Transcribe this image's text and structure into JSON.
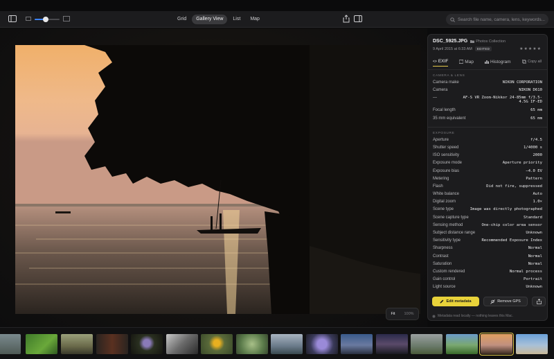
{
  "toolbar": {
    "views": [
      {
        "label": "Grid",
        "active": false
      },
      {
        "label": "Gallery View",
        "active": true
      },
      {
        "label": "List",
        "active": false
      },
      {
        "label": "Map",
        "active": false
      }
    ],
    "zoom_level": 0.45,
    "search_placeholder": "Search file name, camera, lens, keywords..."
  },
  "photo": {
    "filename": "DSC_5925.JPG",
    "collection": "Photos Collection",
    "date": "9 April 2015 at 6:33 AM",
    "badge": "EDITED",
    "rating_stars": "★★★★★",
    "fit_label": "Fit",
    "zoom_label": "100%"
  },
  "panel": {
    "tabs": [
      {
        "label": "EXIF",
        "icon": "code-icon",
        "active": true
      },
      {
        "label": "Map",
        "icon": "map-icon",
        "active": false
      },
      {
        "label": "Histogram",
        "icon": "histogram-icon",
        "active": false
      }
    ],
    "copy_all": "Copy all",
    "camera_section": "CAMERA & LENS",
    "camera_rows": [
      {
        "k": "Camera make",
        "v": "NIKON CORPORATION"
      },
      {
        "k": "Camera",
        "v": "NIKON D610"
      },
      {
        "k": "—",
        "v": "AF-S VR Zoom-Nikkor 24-85mm f/3.5-4.5G IF-ED"
      },
      {
        "k": "Focal length",
        "v": "65 mm"
      },
      {
        "k": "35 mm equivalent",
        "v": "65 mm"
      }
    ],
    "exposure_section": "EXPOSURE",
    "exposure_rows": [
      {
        "k": "Aperture",
        "v": "f/4.5"
      },
      {
        "k": "Shutter speed",
        "v": "1/4000 s"
      },
      {
        "k": "ISO sensitivity",
        "v": "2000"
      },
      {
        "k": "Exposure mode",
        "v": "Aperture priority"
      },
      {
        "k": "Exposure bias",
        "v": "−4.0 EV"
      },
      {
        "k": "Metering",
        "v": "Pattern"
      },
      {
        "k": "Flash",
        "v": "Did not fire, suppressed"
      },
      {
        "k": "White balance",
        "v": "Auto"
      },
      {
        "k": "Digital zoom",
        "v": "1.0×"
      },
      {
        "k": "Scene type",
        "v": "Image was directly photographed"
      },
      {
        "k": "Scene capture type",
        "v": "Standard"
      },
      {
        "k": "Sensing method",
        "v": "One-chip color area sensor"
      },
      {
        "k": "Subject distance range",
        "v": "Unknown"
      },
      {
        "k": "Sensitivity type",
        "v": "Recommended Exposure Index"
      },
      {
        "k": "Sharpness",
        "v": "Normal"
      },
      {
        "k": "Contrast",
        "v": "Normal"
      },
      {
        "k": "Saturation",
        "v": "Normal"
      },
      {
        "k": "Custom rendered",
        "v": "Normal process"
      },
      {
        "k": "Gain control",
        "v": "Portrait"
      },
      {
        "k": "Light source",
        "v": "Unknown"
      }
    ],
    "edit_button": "Edit metadata",
    "remove_gps_button": "Remove GPS",
    "footnote": "Metadata read locally — nothing leaves this Mac."
  },
  "colors": {
    "accent": "#e8d23a",
    "toolbar_bg": "#1c1c1e",
    "panel_bg": "#1c1c1e",
    "slider_fill": "#3b82f6"
  }
}
